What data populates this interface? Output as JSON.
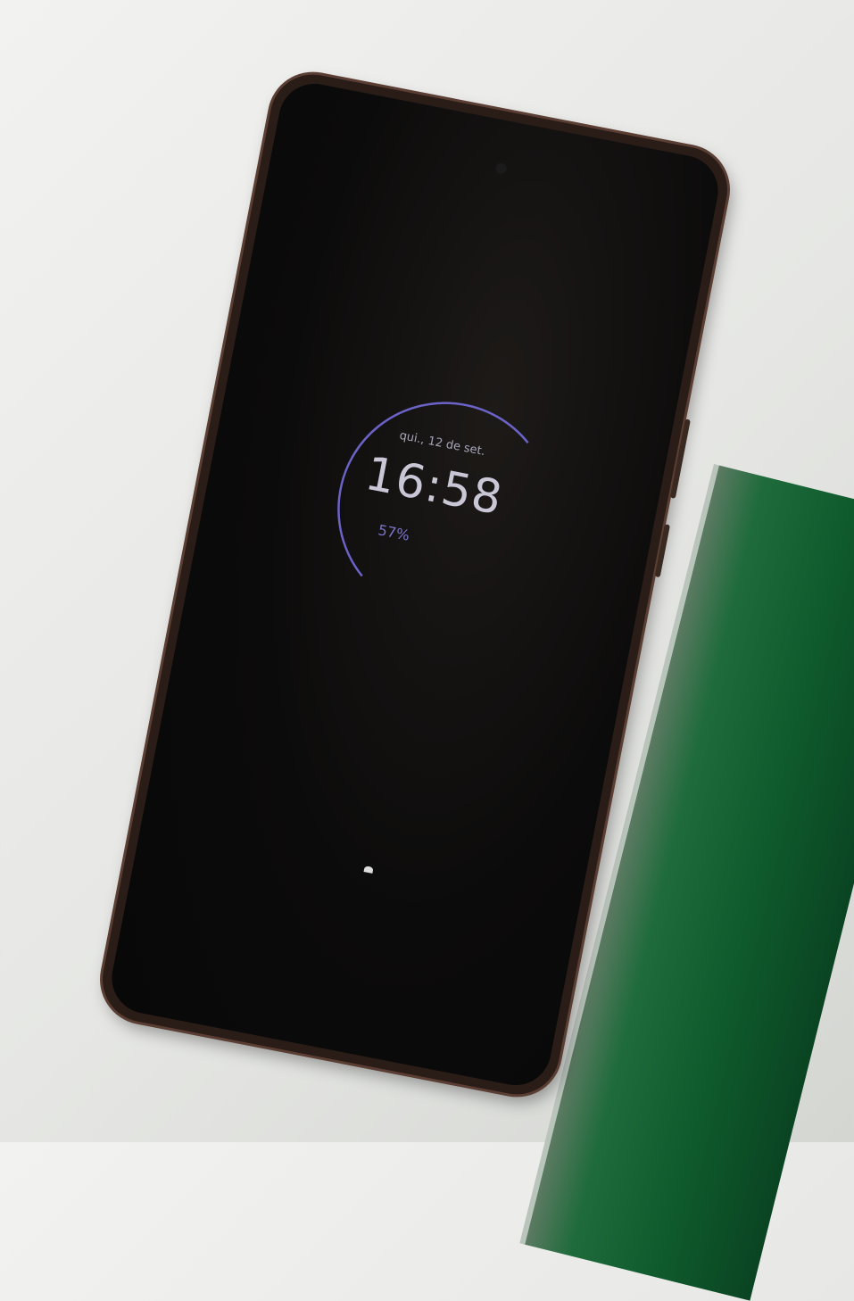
{
  "lockscreen": {
    "date": "qui., 12 de set.",
    "time": "16:58",
    "battery_percent_label": "57%",
    "battery_level": 57,
    "accent_color": "#6b63c7"
  }
}
